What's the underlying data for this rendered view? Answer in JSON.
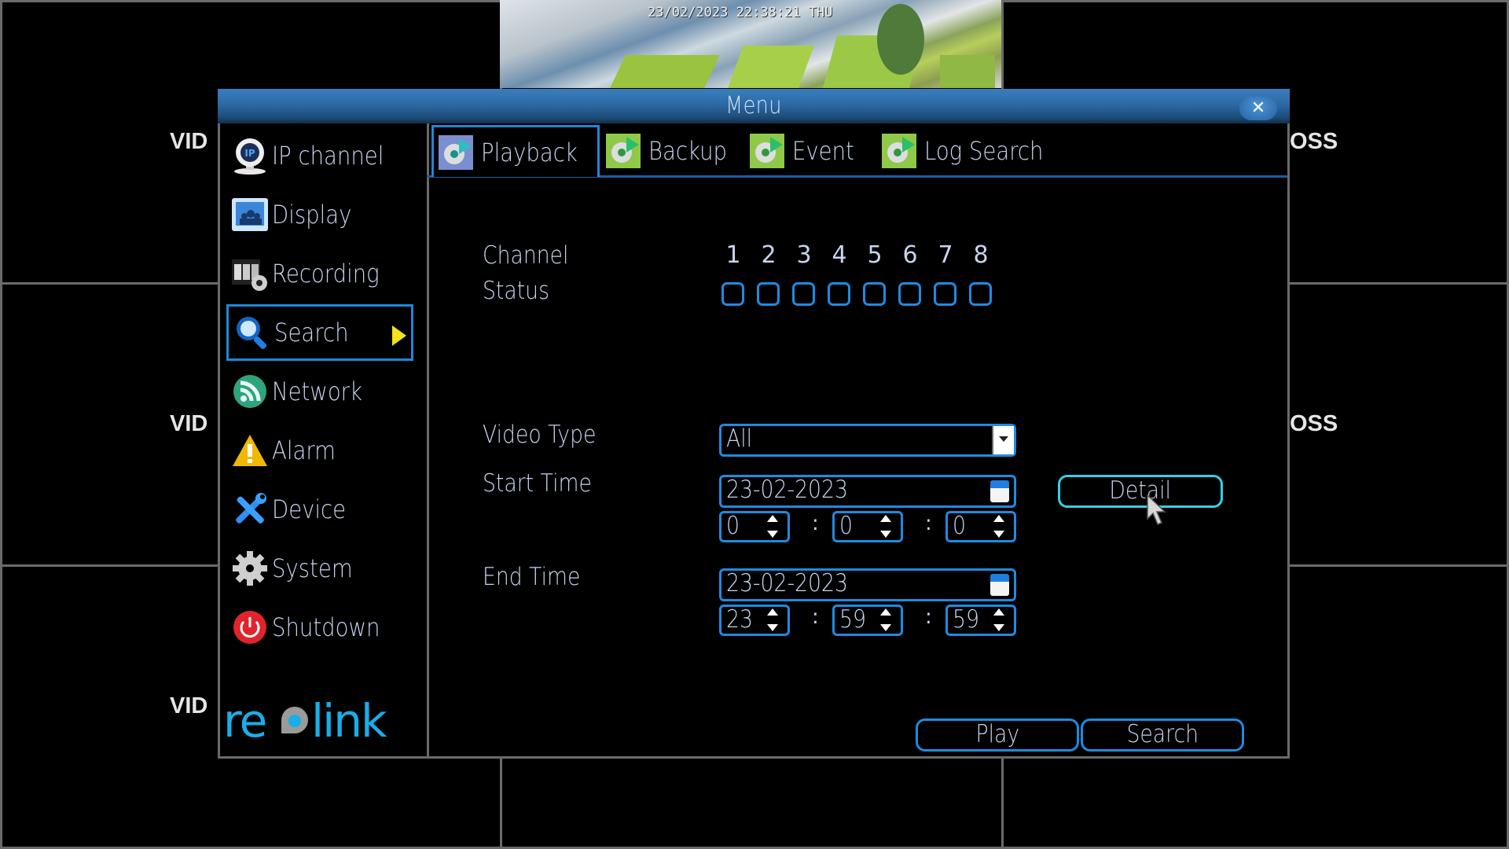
{
  "background": {
    "camera_osd": "23/02/2023 22:38:21 THU",
    "tile_labels": {
      "left_top": "VID",
      "left_middle": "VID",
      "left_bottom": "VID",
      "right_top": "OSS",
      "right_middle": "OSS"
    }
  },
  "window": {
    "title": "Menu",
    "close_icon": "close-icon"
  },
  "sidebar": {
    "items": [
      {
        "label": "IP channel",
        "icon": "webcam-icon"
      },
      {
        "label": "Display",
        "icon": "display-icon"
      },
      {
        "label": "Recording",
        "icon": "film-gear-icon"
      },
      {
        "label": "Search",
        "icon": "magnifier-icon",
        "active": true
      },
      {
        "label": "Network",
        "icon": "rss-icon"
      },
      {
        "label": "Alarm",
        "icon": "warning-icon"
      },
      {
        "label": "Device",
        "icon": "tools-icon"
      },
      {
        "label": "System",
        "icon": "gear-icon"
      },
      {
        "label": "Shutdown",
        "icon": "power-icon"
      }
    ],
    "logo": "reolink"
  },
  "tabs": [
    {
      "label": "Playback",
      "active": true
    },
    {
      "label": "Backup"
    },
    {
      "label": "Event"
    },
    {
      "label": "Log Search"
    }
  ],
  "playback": {
    "channel_label": "Channel",
    "status_label": "Status",
    "channels": [
      "1",
      "2",
      "3",
      "4",
      "5",
      "6",
      "7",
      "8"
    ],
    "channel_checked": [
      false,
      false,
      false,
      false,
      false,
      false,
      false,
      false
    ],
    "video_type_label": "Video Type",
    "video_type_value": "All",
    "start_time_label": "Start Time",
    "start_date": "23-02-2023",
    "start_hour": "0",
    "start_minute": "0",
    "start_second": "0",
    "end_time_label": "End Time",
    "end_date": "23-02-2023",
    "end_hour": "23",
    "end_minute": "59",
    "end_second": "59",
    "time_separator": ":",
    "detail_button": "Detail",
    "play_button": "Play",
    "search_button": "Search"
  },
  "colors": {
    "accent_border": "#1f8be0",
    "detail_border": "#35d0e6",
    "title_bar": "#2c6aa5",
    "text": "#c8d4f0",
    "active_arrow": "#f5e31a"
  }
}
